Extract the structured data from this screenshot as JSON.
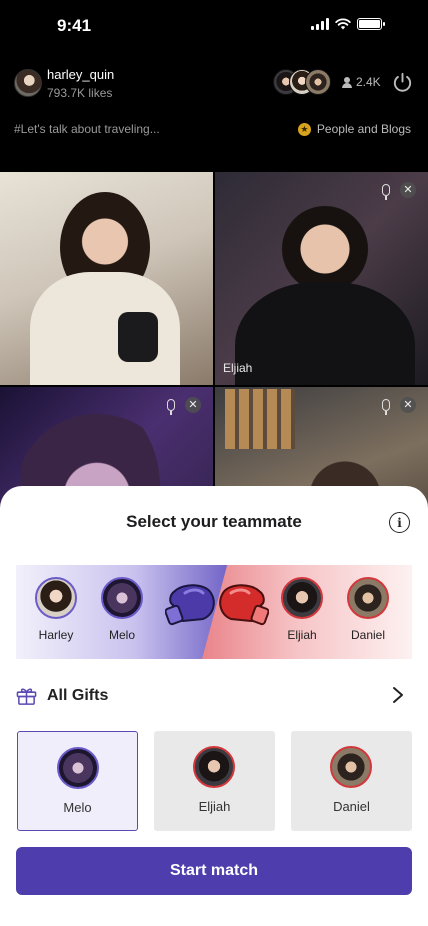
{
  "status_bar": {
    "time": "9:41"
  },
  "host": {
    "name": "harley_quin",
    "likes": "793.7K likes"
  },
  "viewers": {
    "count": "2.4K"
  },
  "stream": {
    "tagline": "#Let's talk about traveling...",
    "category": "People and Blogs"
  },
  "tiles": [
    {
      "name": ""
    },
    {
      "name": "Eljiah"
    },
    {
      "name": ""
    },
    {
      "name": ""
    }
  ],
  "sheet": {
    "title": "Select your teammate",
    "info_glyph": "i",
    "versus": {
      "left": [
        {
          "name": "Harley"
        },
        {
          "name": "Melo"
        }
      ],
      "right": [
        {
          "name": "Eljiah"
        },
        {
          "name": "Daniel"
        }
      ]
    },
    "gifts_label": "All Gifts",
    "teammates": [
      {
        "name": "Melo",
        "selected": true
      },
      {
        "name": "Eljiah",
        "selected": false
      },
      {
        "name": "Daniel",
        "selected": false
      }
    ],
    "start_label": "Start match"
  },
  "colors": {
    "accent": "#4e3ead",
    "team_left": "#6a5bc8",
    "team_right": "#d2383b",
    "category_star": "#d8a41e"
  },
  "icons": [
    "signal-icon",
    "wifi-icon",
    "battery-icon",
    "person-icon",
    "power-icon",
    "star-icon",
    "mic-icon",
    "close-icon",
    "info-icon",
    "gift-icon",
    "chevron-right-icon",
    "boxing-glove-icon"
  ]
}
